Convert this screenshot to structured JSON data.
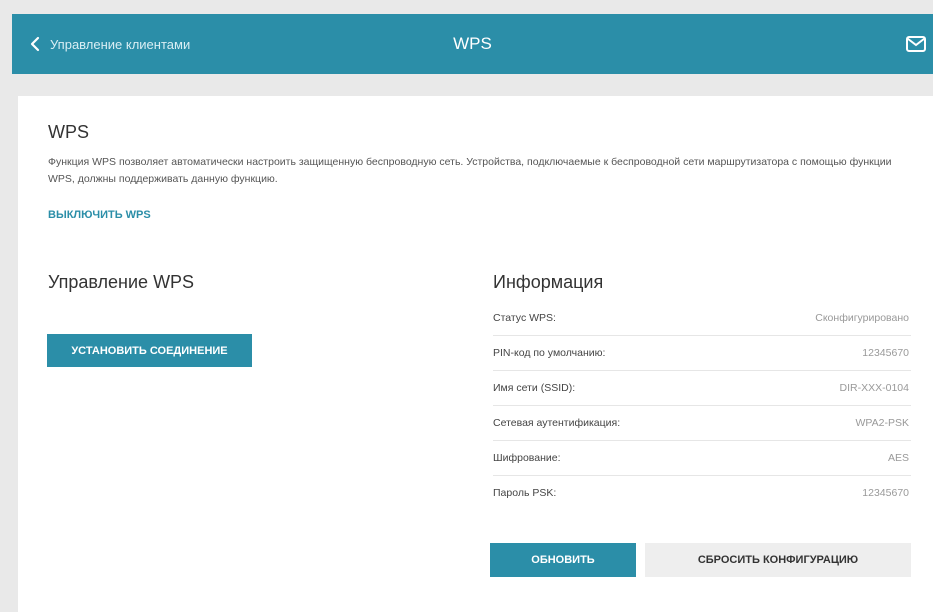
{
  "header": {
    "back_label": "Управление клиентами",
    "title": "WPS",
    "accent_color": "#2b8ea8"
  },
  "wps": {
    "title": "WPS",
    "description": "Функция WPS позволяет автоматически настроить защищенную беспроводную сеть. Устройства, подключаемые к беспроводной сети маршрутизатора с помощью функции WPS, должны поддерживать данную функцию.",
    "disable_link": "ВЫКЛЮЧИТЬ WPS"
  },
  "management": {
    "title": "Управление WPS",
    "connect_button": "УСТАНОВИТЬ СОЕДИНЕНИЕ"
  },
  "info": {
    "title": "Информация",
    "rows": [
      {
        "label": "Статус WPS:",
        "value": "Сконфигурировано"
      },
      {
        "label": "PIN-код по умолчанию:",
        "value": "12345670"
      },
      {
        "label": "Имя сети (SSID):",
        "value": "DIR-XXX-0104"
      },
      {
        "label": "Сетевая аутентификация:",
        "value": "WPA2-PSK"
      },
      {
        "label": "Шифрование:",
        "value": "AES"
      },
      {
        "label": "Пароль PSK:",
        "value": "12345670"
      }
    ],
    "refresh_button": "ОБНОВИТЬ",
    "reset_button": "СБРОСИТЬ КОНФИГУРАЦИЮ"
  },
  "icons": {
    "back": "chevron-left-icon",
    "mail": "mail-icon"
  }
}
